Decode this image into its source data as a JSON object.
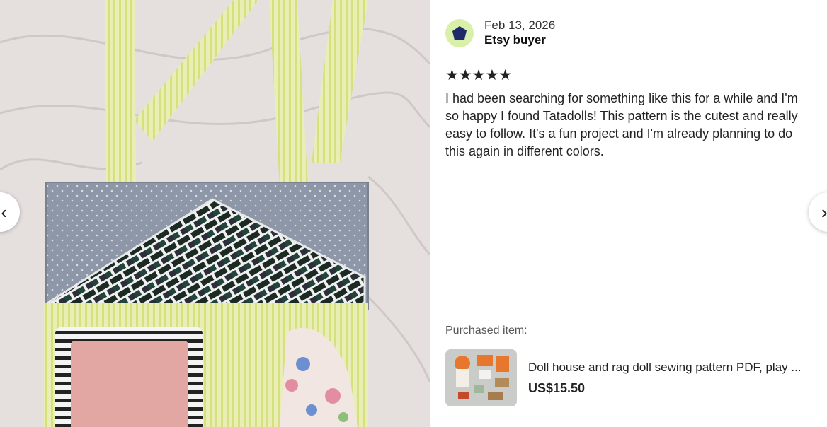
{
  "review": {
    "date": "Feb 13, 2026",
    "reviewer": "Etsy buyer",
    "rating": 5,
    "stars": "★★★★★",
    "text": "I had been searching for something like this for a while and I'm so happy I found Tatadolls! This pattern is the cutest and really easy to follow. It's a fun project and I'm already planning to do this again in different colors."
  },
  "purchased": {
    "label": "Purchased item:",
    "title": "Doll house and rag doll sewing pattern PDF, play ...",
    "price": "US$15.50"
  },
  "nav": {
    "prev_icon": "chevron-left-icon",
    "next_icon": "chevron-right-icon",
    "prev_glyph": "‹",
    "next_glyph": "›"
  },
  "colors": {
    "avatar_bg": "#d9f0a8",
    "avatar_fg": "#1f2a6b"
  }
}
